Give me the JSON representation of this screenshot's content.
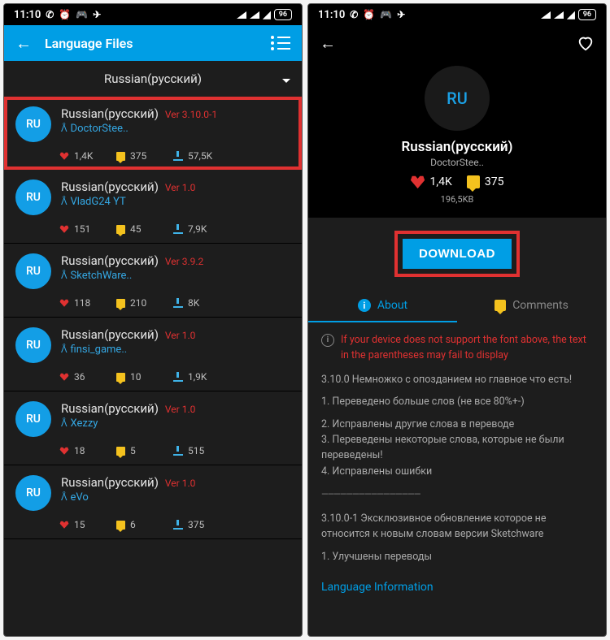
{
  "status": {
    "time": "11:10",
    "battery": "96"
  },
  "left": {
    "header_title": "Language Files",
    "selector_label": "Russian(русский)",
    "items": [
      {
        "avatar": "RU",
        "name": "Russian(русский)",
        "ver": "Ver 3.10.0-1",
        "author": "DoctorStee..",
        "likes": "1,4K",
        "comments": "375",
        "downloads": "57,5K",
        "highlight": true
      },
      {
        "avatar": "RU",
        "name": "Russian(русский)",
        "ver": "Ver 1.0",
        "author": "VladG24 YT",
        "likes": "151",
        "comments": "45",
        "downloads": "7,9K"
      },
      {
        "avatar": "RU",
        "name": "Russian(русский)",
        "ver": "Ver 3.9.2",
        "author": "SketchWare..",
        "likes": "118",
        "comments": "210",
        "downloads": "8K"
      },
      {
        "avatar": "RU",
        "name": "Russian(русский)",
        "ver": "Ver 1.0",
        "author": "finsi_game..",
        "likes": "36",
        "comments": "10",
        "downloads": "1,9K"
      },
      {
        "avatar": "RU",
        "name": "Russian(русский)",
        "ver": "Ver 1.0",
        "author": "Xezzy",
        "likes": "18",
        "comments": "5",
        "downloads": "515"
      },
      {
        "avatar": "RU",
        "name": "Russian(русский)",
        "ver": "Ver 1.0",
        "author": "eVo",
        "likes": "15",
        "comments": "6",
        "downloads": "375"
      }
    ]
  },
  "right": {
    "avatar": "RU",
    "title": "Russian(русский)",
    "author": "DoctorStee..",
    "likes": "1,4K",
    "comments": "375",
    "size": "196,5KB",
    "download_label": "DOWNLOAD",
    "tabs": {
      "about": "About",
      "comments": "Comments"
    },
    "warning": "If your device does not support the font above, the text in the parentheses may fail to display",
    "line0": "3.10.0 Немножко с опозданием но главное что есть!",
    "list1": "1. Переведено больше слов (не все 80%+-)",
    "list2": "2. Исправлены другие слова в переводе",
    "list3": "3. Переведены некоторые слова, которые не были переведены!",
    "list4": "4. Исправлены ошибки",
    "divider": "————————————————",
    "line5": "3.10.0-1 Эксклюзивное обновление которое не относится к новым словам версии Sketchware",
    "line6": "1. Улучшены переводы",
    "footer": "Language Information"
  }
}
